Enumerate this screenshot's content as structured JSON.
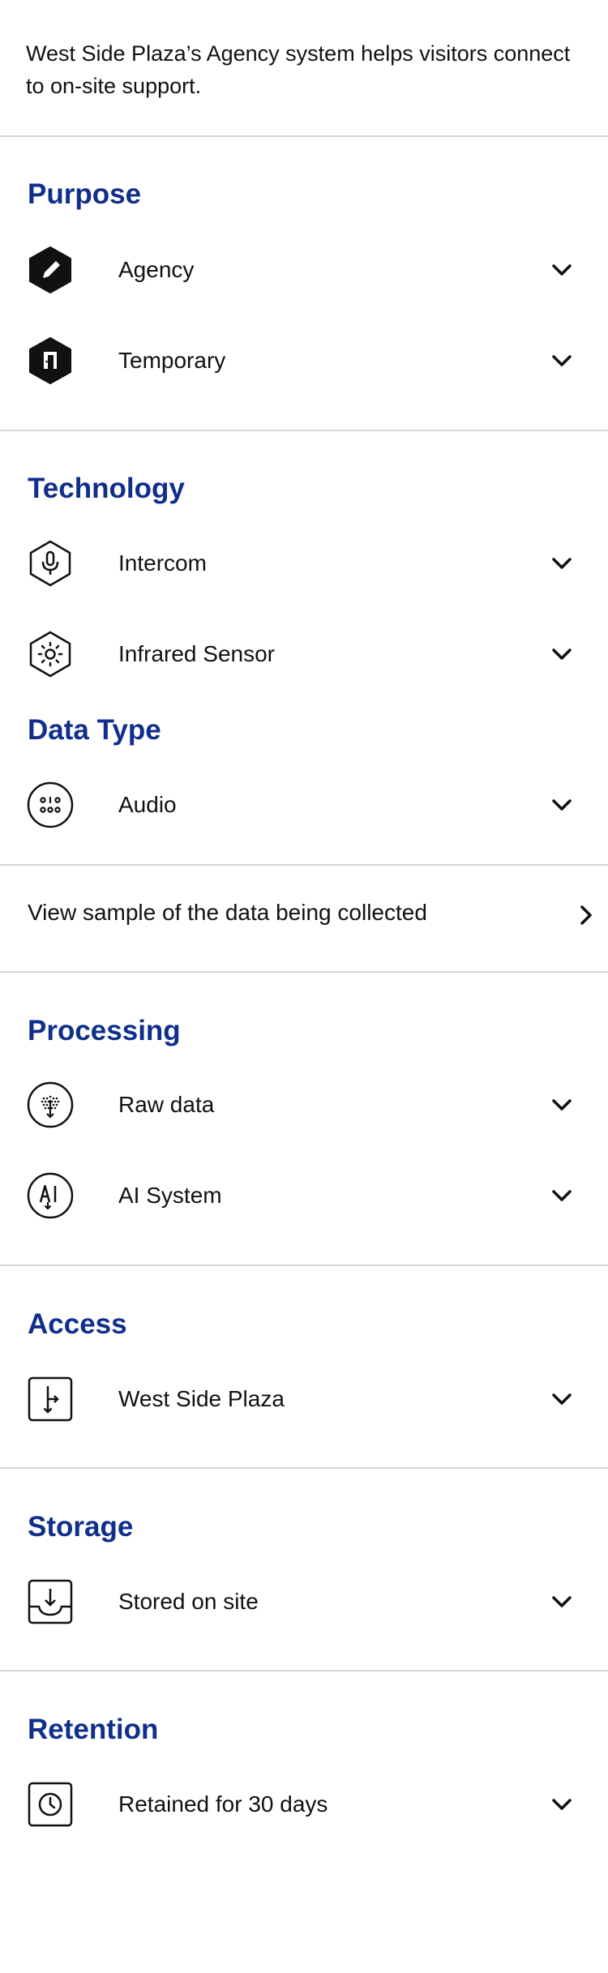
{
  "intro": "West Side Plaza’s Agency system helps visitors connect to on-site support.",
  "sections": {
    "purpose": {
      "title": "Purpose",
      "items": [
        {
          "label": "Agency",
          "icon": "pencil-hexagon-icon"
        },
        {
          "label": "Temporary",
          "icon": "door-hexagon-icon"
        }
      ]
    },
    "technology": {
      "title": "Technology",
      "items": [
        {
          "label": "Intercom",
          "icon": "microphone-hexagon-icon"
        },
        {
          "label": "Infrared Sensor",
          "icon": "sun-hexagon-icon"
        }
      ]
    },
    "data_type": {
      "title": "Data Type",
      "items": [
        {
          "label": "Audio",
          "icon": "audio-circle-icon"
        }
      ]
    },
    "sample_link": {
      "label": "View sample of the data being collected",
      "icon": "chevron-right-icon"
    },
    "processing": {
      "title": "Processing",
      "items": [
        {
          "label": "Raw data",
          "icon": "raw-data-circle-icon"
        },
        {
          "label": "AI System",
          "icon": "ai-circle-icon"
        }
      ]
    },
    "access": {
      "title": "Access",
      "items": [
        {
          "label": "West Side Plaza",
          "icon": "access-square-icon"
        }
      ]
    },
    "storage": {
      "title": "Storage",
      "items": [
        {
          "label": "Stored on site",
          "icon": "tray-download-icon"
        }
      ]
    },
    "retention": {
      "title": "Retention",
      "items": [
        {
          "label": "Retained for 30 days",
          "icon": "clock-square-icon"
        }
      ]
    }
  },
  "colors": {
    "heading": "#102f8c",
    "text": "#111111",
    "divider": "#d6d6d6",
    "background": "#ffffff"
  }
}
